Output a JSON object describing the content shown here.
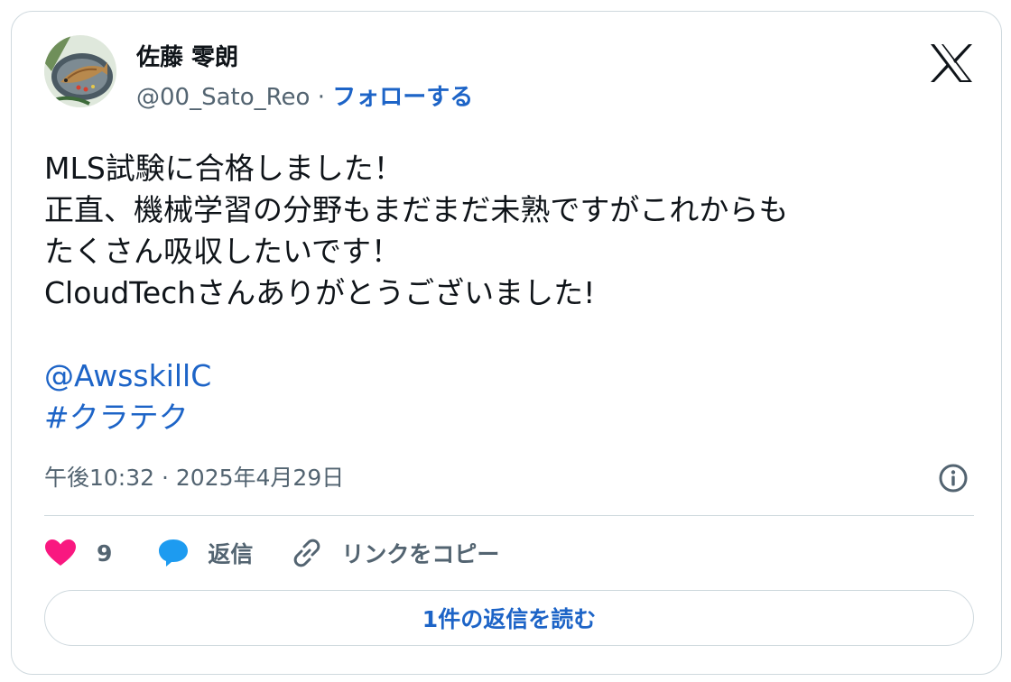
{
  "tweet": {
    "author": {
      "name": "佐藤 零朗",
      "handle": "@00_Sato_Reo",
      "separator": " · ",
      "follow_label": "フォローする"
    },
    "body": {
      "lines": [
        "MLS試験に合格しました！",
        "正直、機械学習の分野もまだまだ未熟ですがこれからも",
        "たくさん吸収したいです！",
        "CloudTechさんありがとうございました!"
      ],
      "mention": "@AwsskillC",
      "hashtag": "#クラテク"
    },
    "timestamp": "午後10:32 · 2025年4月29日",
    "actions": {
      "like_count": "9",
      "reply_label": "返信",
      "copy_link_label": "リンクをコピー"
    },
    "read_replies_label": "1件の返信を読む"
  },
  "colors": {
    "link": "#1d64c7",
    "like": "#f91880",
    "reply": "#1d9bf0",
    "secondary_text": "#536471",
    "border": "#cfd9de"
  },
  "icons": {
    "avatar": "grilled-fish-plate-avatar",
    "brand": "x-logo",
    "info": "info-circle-icon",
    "like": "heart-icon",
    "reply": "speech-bubble-icon",
    "copy": "link-chain-icon"
  }
}
